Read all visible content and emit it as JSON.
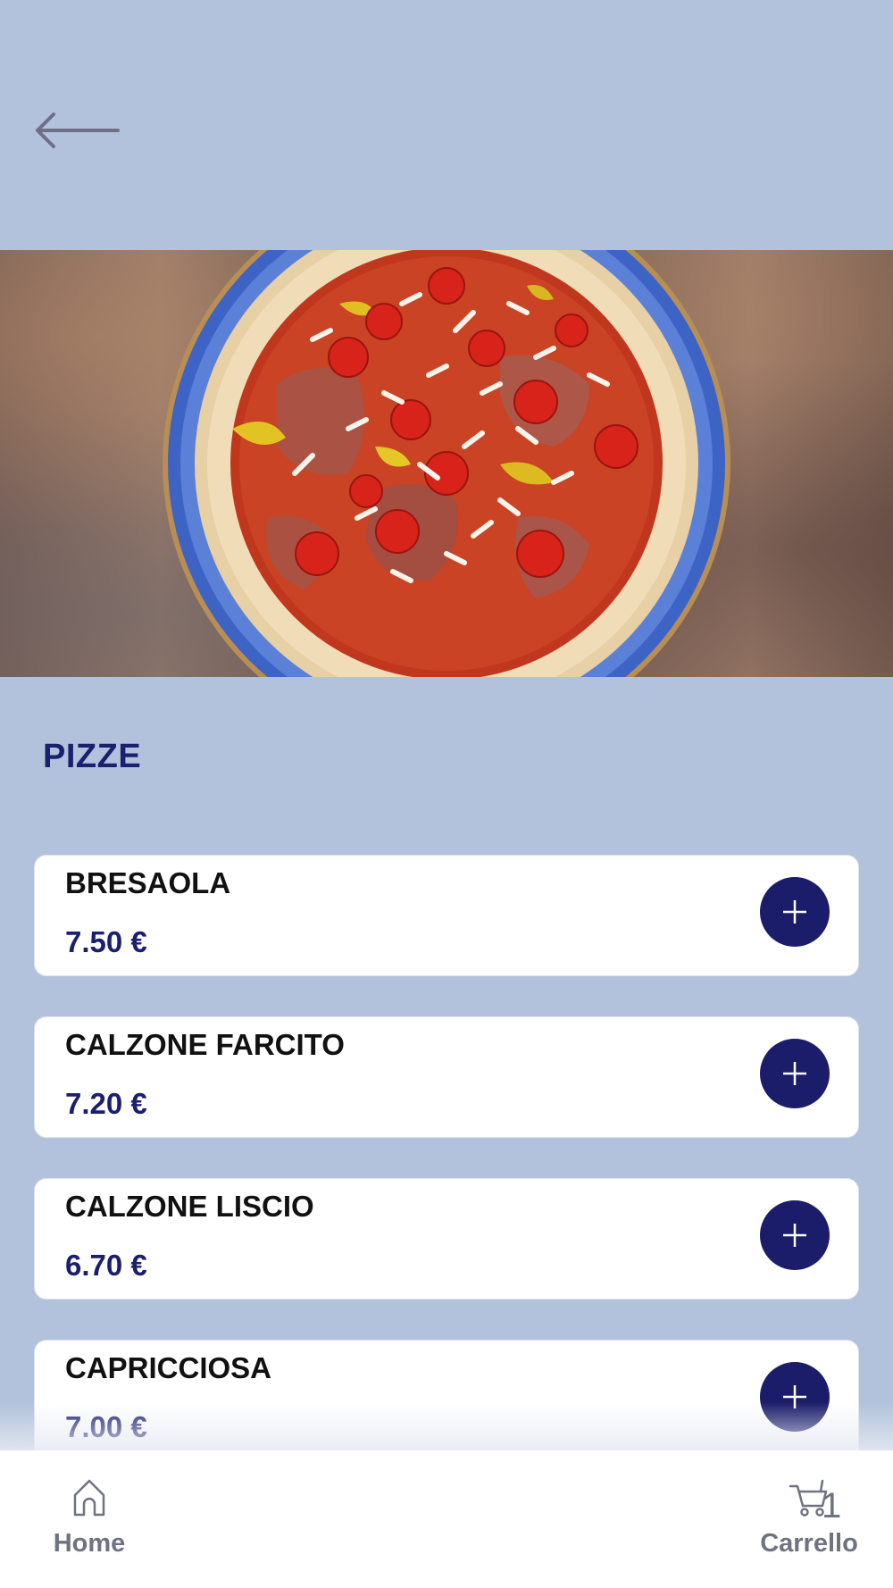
{
  "section": {
    "title": "PIZZE"
  },
  "products": [
    {
      "name": "BRESAOLA",
      "price": "7.50 €"
    },
    {
      "name": "CALZONE FARCITO",
      "price": "7.20 €"
    },
    {
      "name": "CALZONE LISCIO",
      "price": "6.70 €"
    },
    {
      "name": "CAPRICCIOSA",
      "price": "7.00 €"
    }
  ],
  "nav": {
    "home_label": "Home",
    "cart_label": "Carrello",
    "cart_count": "1"
  },
  "colors": {
    "background": "#b2c2dc",
    "accent": "#1b1d6b",
    "card": "#ffffff",
    "muted": "#6f7380"
  },
  "icons": {
    "back": "arrow-left-icon",
    "add": "plus-icon",
    "home": "home-icon",
    "cart": "cart-icon"
  }
}
